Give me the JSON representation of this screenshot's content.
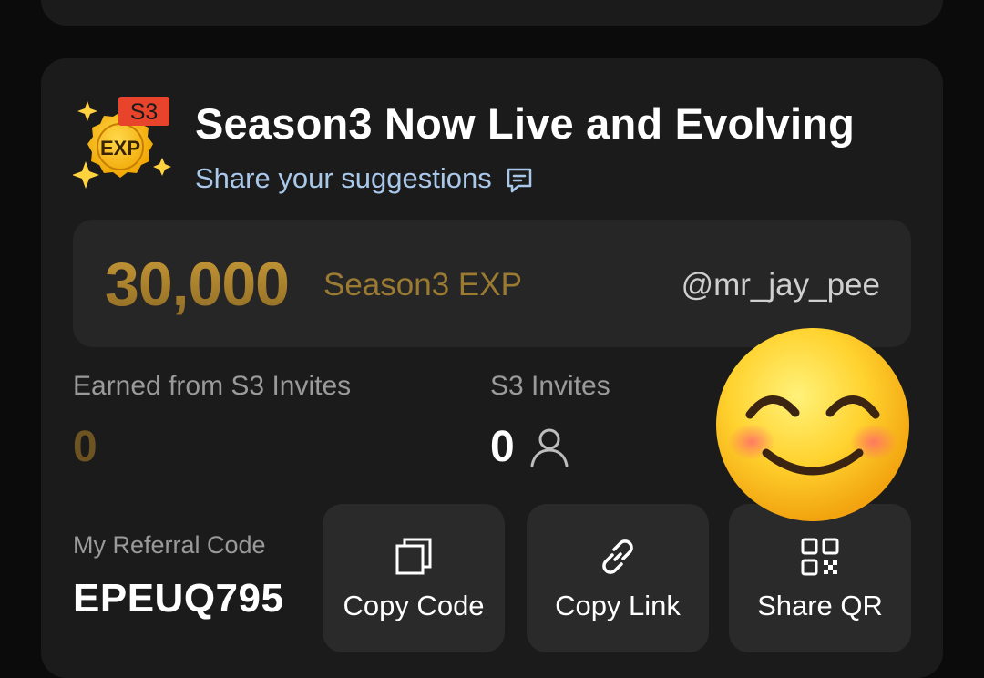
{
  "badge": {
    "season_tag": "S3",
    "text": "EXP",
    "icon": "season-exp-badge"
  },
  "header": {
    "title": "Season3 Now Live and Evolving",
    "suggestions_link": "Share your suggestions",
    "suggestions_icon": "message-square-icon"
  },
  "exp": {
    "value": "30,000",
    "label": "Season3 EXP",
    "username": "@mr_jay_pee"
  },
  "stats": {
    "earned_label": "Earned from S3 Invites",
    "earned_value": "0",
    "invites_label": "S3 Invites",
    "invites_value": "0",
    "invites_icon": "user-icon"
  },
  "referral": {
    "label": "My Referral Code",
    "code": "EPEUQ795"
  },
  "actions": [
    {
      "label": "Copy Code",
      "icon": "copy-icon"
    },
    {
      "label": "Copy Link",
      "icon": "link-icon"
    },
    {
      "label": "Share QR",
      "icon": "qr-code-icon"
    }
  ],
  "overlay": {
    "emoji": "smiling-face-emoji"
  },
  "colors": {
    "background": "#0b0b0b",
    "card": "#1b1b1b",
    "panel": "#262626",
    "gold": "#c99a38",
    "link": "#a9c8ea",
    "badge_red": "#e8432b"
  }
}
